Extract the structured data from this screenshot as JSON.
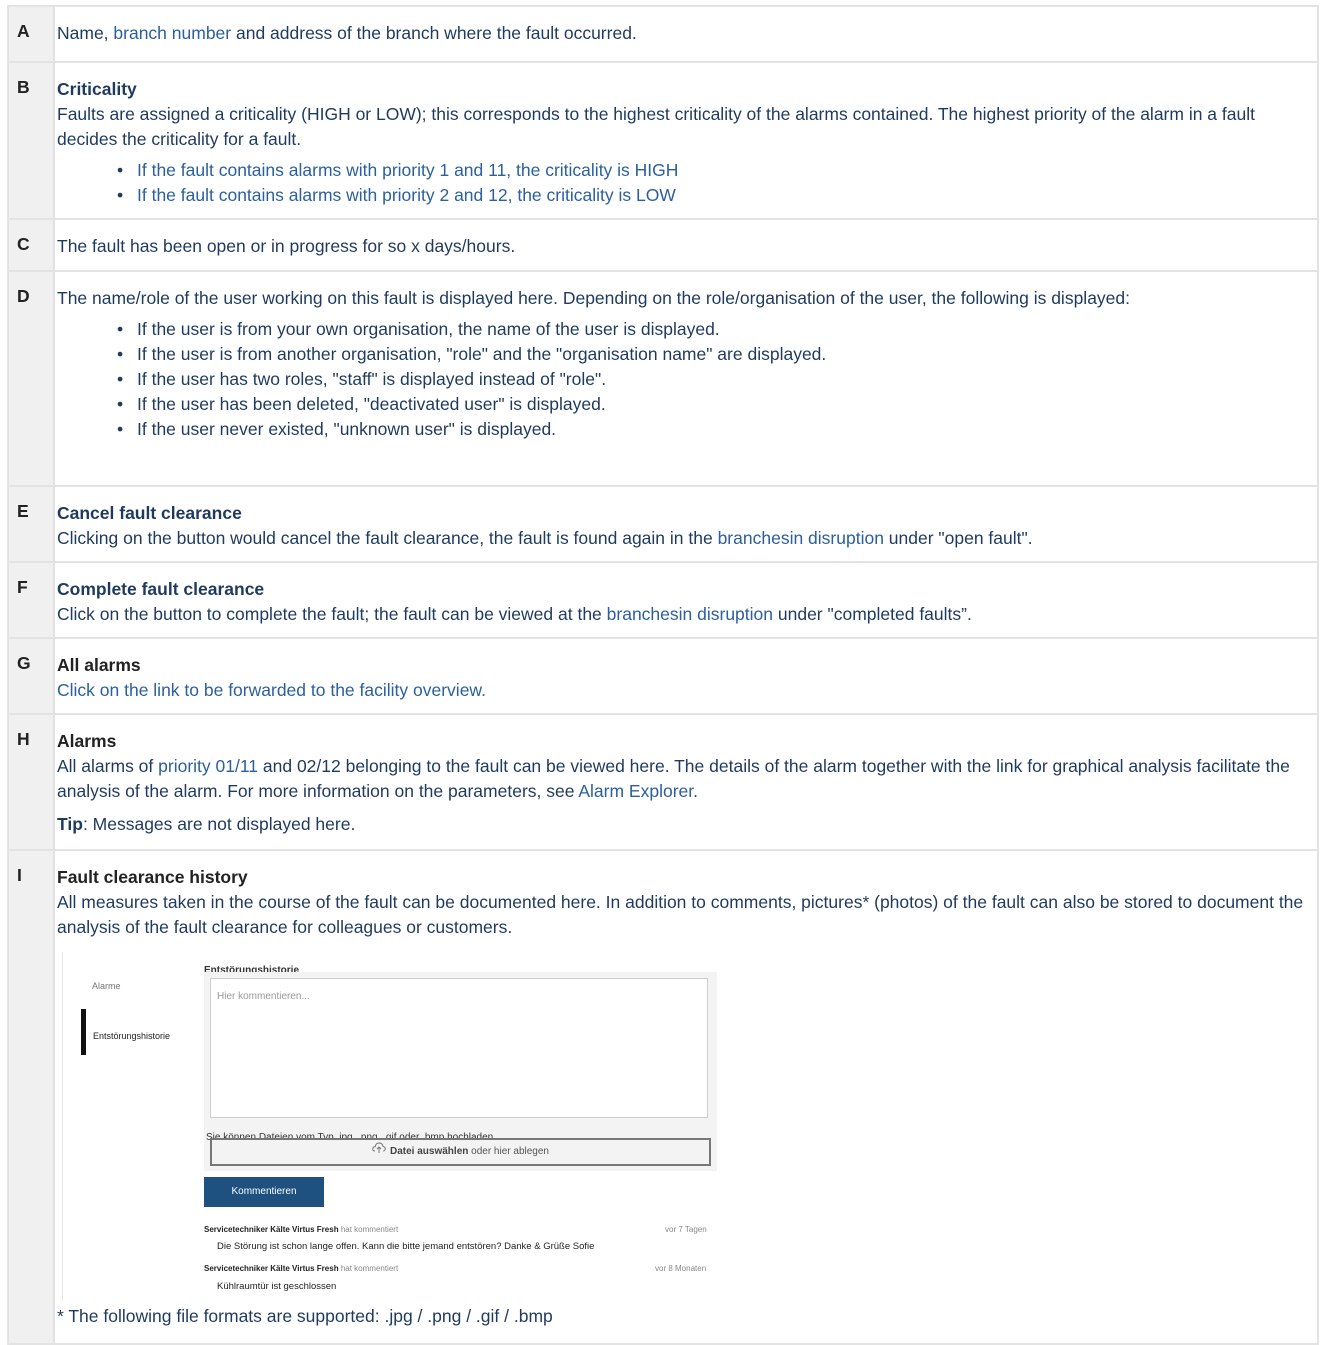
{
  "rows": {
    "A": {
      "key": "A",
      "p1": "Name, ",
      "link1": "branch number",
      "p2": " and address of the branch where the fault occurred."
    },
    "B": {
      "key": "B",
      "title": "Criticality",
      "text": "Faults are assigned a criticality (HIGH or LOW); this corresponds to the highest criticality of the alarms contained. The highest priority of the alarm in a fault decides the criticality for a fault.",
      "bullets": [
        "If the fault contains alarms with priority 1 and 11, the criticality is HIGH",
        "If the fault contains alarms with priority 2 and 12, the criticality is LOW"
      ]
    },
    "C": {
      "key": "C",
      "text": "The fault has been open or in progress for so x days/hours."
    },
    "D": {
      "key": "D",
      "text": "The name/role of the user working on this fault is displayed here. Depending on the role/organisation of the user, the following is displayed:",
      "bullets": [
        "If the user is from your own organisation, the name of the user is displayed.",
        "If the user is from another organisation, \"role\" and the \"organisation name\" are displayed.",
        "If the user has two roles, \"staff\" is displayed instead of \"role\".",
        "If the user has been deleted, \"deactivated user\" is displayed.",
        "If the user never existed, \"unknown user\" is displayed."
      ]
    },
    "E": {
      "key": "E",
      "title": "Cancel fault clearance",
      "p1": "Clicking on the button would cancel the fault clearance, the fault is found again in the ",
      "link": "branchesin disruption",
      "p2": " under \"open fault\"."
    },
    "F": {
      "key": "F",
      "title": "Complete fault clearance",
      "p1": "Click on the button to complete the fault; the fault can be viewed at the ",
      "link": "branchesin disruption",
      "p2": " under \"completed faults”."
    },
    "G": {
      "key": "G",
      "title": "All alarms",
      "p1": "Click on the link to be forwarded to the ",
      "link": "facility overview",
      "p2": "."
    },
    "H": {
      "key": "H",
      "title": "Alarms",
      "p1": "All alarms of ",
      "s1": "priority 01/11",
      "p2": " and 02/12 belonging to the fault can be viewed here. The details of the alarm together with the link for graphical analysis facilitate the analysis of the alarm. For more information on the parameters, see ",
      "link": "Alarm Explorer",
      "p3": ".",
      "tip_label": "Tip",
      "tip_text": ": Messages are not displayed here."
    },
    "I": {
      "key": "I",
      "title": "Fault clearance history",
      "text": "All measures taken in the course of the fault can be documented here. In addition to comments, pictures* (photos) of the fault can also be stored to document the analysis of the fault clearance for colleagues or customers.",
      "footnote": "* The following file formats are supported: .jpg / .png / .gif / .bmp"
    }
  },
  "screenshot": {
    "nav": [
      "Alarme",
      "Entstörungshistorie"
    ],
    "heading": "Entstörungshistorie",
    "placeholder": "Hier kommentieren...",
    "hint": "Sie können Dateien vom Typ .jpg, .png, .gif oder .bmp hochladen.",
    "upload_bold": "Datei auswählen",
    "upload_rest": " oder hier ablegen",
    "button": "Kommentieren",
    "comments": [
      {
        "author": "Servicetechniker Kälte Virtus Fresh",
        "action": " hat kommentiert",
        "time": "vor 7 Tagen",
        "text": "Die Störung ist schon lange offen. Kann die bitte jemand entstören? Danke & Grüße Sofie"
      },
      {
        "author": "Servicetechniker Kälte Virtus Fresh",
        "action": " hat kommentiert",
        "time": "vor 8 Monaten",
        "text": "Kühlraumtür ist geschlossen"
      }
    ]
  }
}
